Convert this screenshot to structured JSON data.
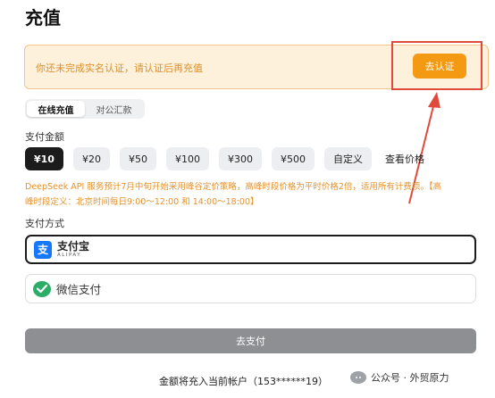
{
  "page": {
    "title": "充值"
  },
  "notice": {
    "text": "你还未完成实名认证，请认证后再充值",
    "verify_label": "去认证"
  },
  "tabs": [
    {
      "label": "在线充值",
      "active": true
    },
    {
      "label": "对公汇款",
      "active": false
    }
  ],
  "amount_section": {
    "label": "支付金额",
    "options": [
      "¥10",
      "¥20",
      "¥50",
      "¥100",
      "¥300",
      "¥500",
      "自定义"
    ],
    "selected": "¥10",
    "price_link": "查看价格"
  },
  "pricing_note": {
    "line1": "DeepSeek API 服务预计7月中旬开始采用峰谷定价策略，高峰时段价格为平时价格2倍，适用所有计费项。【高",
    "line2": "峰时段定义：北京时间每日9:00～12:00 和 14:00～18:00】"
  },
  "payment_section": {
    "label": "支付方式",
    "alipay": {
      "name": "支付宝",
      "sub": "ALIPAY"
    },
    "wechat": {
      "name": "微信支付"
    }
  },
  "submit": {
    "label": "去支付"
  },
  "account_note": "金额将充入当前帐户（153******19）",
  "watermark": "公众号 · 外贸原力",
  "colors": {
    "accent": "#f39a12",
    "notice_bg": "#fdf1dc",
    "highlight": "#e04a3c",
    "alipay": "#1677ff",
    "wechat": "#2aae67"
  }
}
